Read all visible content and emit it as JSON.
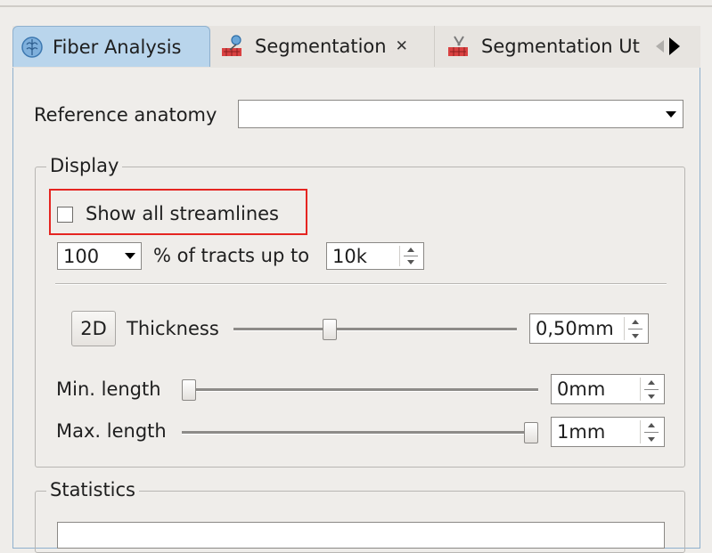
{
  "tabs": [
    {
      "label": "Fiber Analysis",
      "icon": "brain-icon",
      "active": true
    },
    {
      "label": "Segmentation",
      "icon": "segmentation-icon",
      "closable": true
    },
    {
      "label": "Segmentation Ut",
      "icon": "segmentation-utilities-icon"
    }
  ],
  "reference": {
    "label": "Reference anatomy",
    "value": ""
  },
  "display": {
    "legend": "Display",
    "show_all_streamlines": {
      "label": "Show all streamlines",
      "checked": false
    },
    "percent": {
      "value": "100",
      "label": "% of tracts up to",
      "limit": "10k"
    },
    "thickness": {
      "button": "2D",
      "label": "Thickness",
      "value": "0,50mm",
      "slider_fraction": 0.33
    },
    "min_length": {
      "label": "Min. length",
      "value": "0mm",
      "slider_fraction": 0.0
    },
    "max_length": {
      "label": "Max. length",
      "value": "1mm",
      "slider_fraction": 1.0
    }
  },
  "statistics": {
    "legend": "Statistics"
  },
  "colors": {
    "active_tab": "#b9d5ec",
    "highlight": "#e52521",
    "background": "#efedea"
  }
}
